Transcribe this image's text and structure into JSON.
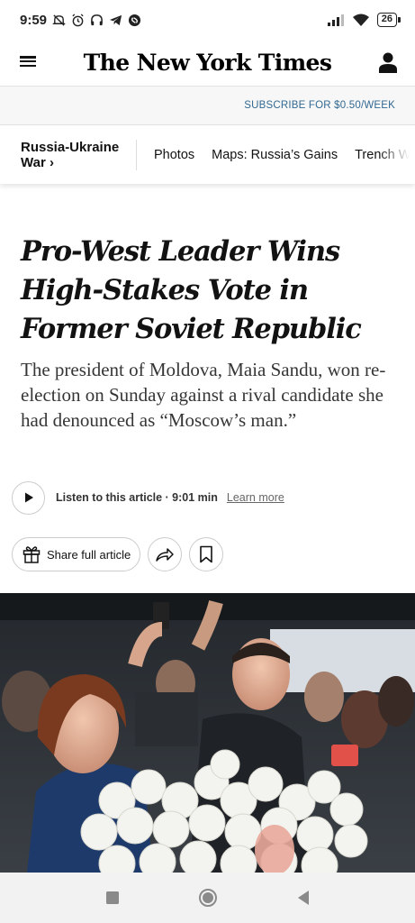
{
  "status_bar": {
    "time": "9:59",
    "battery": "26",
    "icons": [
      "mute-icon",
      "alarm-icon",
      "headphones-icon",
      "telegram-icon",
      "shazam-icon",
      "signal-icon",
      "wifi-icon",
      "battery-icon"
    ]
  },
  "header": {
    "logo": "The New York Times",
    "menu_icon": "hamburger-menu-icon",
    "account_icon": "account-icon"
  },
  "subscribe": {
    "label": "SUBSCRIBE FOR $0.50/WEEK"
  },
  "section_nav": {
    "title_line1": "Russia-Ukraine",
    "title_line2": "War ›",
    "items": [
      "Photos",
      "Maps: Russia’s Gains",
      "Trench W"
    ]
  },
  "article": {
    "headline": "Pro-West Leader Wins High-Stakes Vote in Former Soviet Republic",
    "summary": "The president of Moldova, Maia Sandu, won re-election on Sunday against a rival candidate she had denounced as “Moscow’s man.”",
    "listen_label": "Listen to this article · 9:01 min",
    "learn_more": "Learn more",
    "share_label": "Share full article"
  },
  "colors": {
    "link_blue": "#326891",
    "text": "#121212",
    "subscribe_bg": "#f7f7f7"
  }
}
